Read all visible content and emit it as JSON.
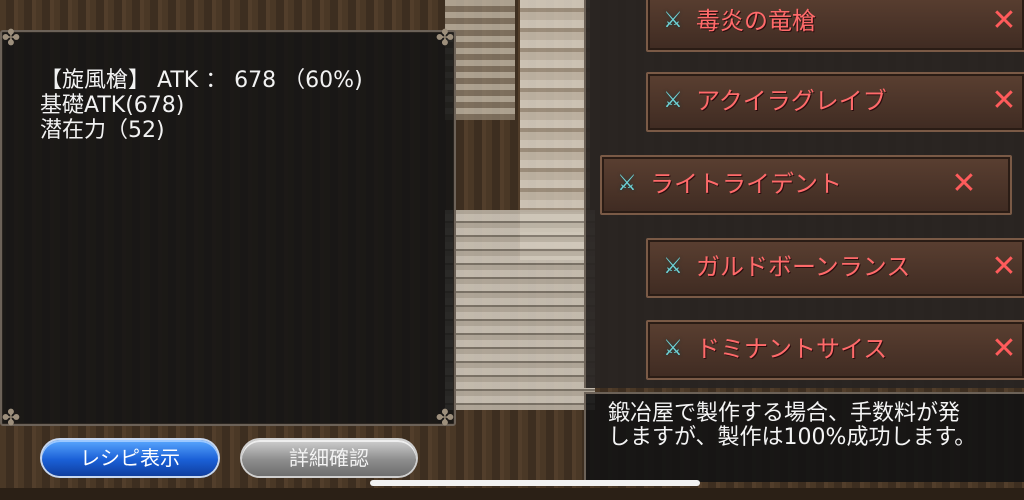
{
  "weapon_info": {
    "line1": "【旋風槍】 ATK ： 678 （60%)",
    "line2": "基礎ATK(678)",
    "line3": "潜在力（52)"
  },
  "weapon_list": [
    {
      "name": "毒炎の竜槍",
      "icon": "spear-icon",
      "remove": "✕"
    },
    {
      "name": "アクイラグレイブ",
      "icon": "spear-icon",
      "remove": "✕"
    },
    {
      "name": "ライトライデント",
      "icon": "spear-icon",
      "remove": "✕"
    },
    {
      "name": "ガルドボーンランス",
      "icon": "spear-icon",
      "remove": "✕"
    },
    {
      "name": "ドミナントサイス",
      "icon": "spear-icon",
      "remove": "✕"
    }
  ],
  "message": {
    "line1": "鍛冶屋で製作する場合、手数料が発",
    "line2": "しますが、製作は100%成功します。"
  },
  "buttons": {
    "recipe": "レシピ表示",
    "detail": "詳細確認"
  },
  "colors": {
    "item_text": "#ff6a6a",
    "recipe_button": "#1a5fd6",
    "detail_button": "#8d8d8d"
  }
}
